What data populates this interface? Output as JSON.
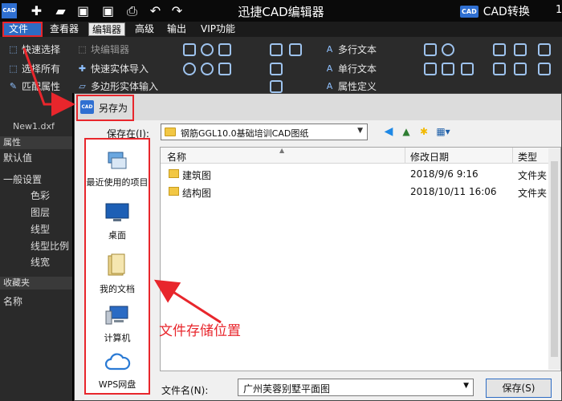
{
  "titlebar": {
    "app_logo": "CAD",
    "title": "迅捷CAD编辑器",
    "convert_badge": "CAD",
    "convert_label": "CAD转换",
    "user_fragment": "1"
  },
  "menu": {
    "file": "文件",
    "items": [
      "查看器",
      "编辑器",
      "高级",
      "输出",
      "VIP功能"
    ]
  },
  "ribbon": {
    "quick_select": "快速选择",
    "select_all": "选择所有",
    "match_props": "匹配属性",
    "block_editor": "块编辑器",
    "quick_entity_import": "快速实体导入",
    "polyline_import": "多边形实体输入",
    "multiline_text": "多行文本",
    "single_text": "单行文本",
    "attr_def": "属性定义"
  },
  "left_panel": {
    "doc_tab": "New1.dxf",
    "props_header": "属性",
    "default": "默认值",
    "general": "一般设置",
    "rows": [
      "色彩",
      "图层",
      "线型",
      "线型比例",
      "线宽"
    ],
    "favorites": "收藏夹",
    "name": "名称"
  },
  "dialog": {
    "icon": "CAD",
    "title": "另存为",
    "save_in_label": "保存在(I):",
    "save_in_value": "钢筋GGL10.0基础培训CAD图纸",
    "places": [
      "最近使用的项目",
      "桌面",
      "我的文档",
      "计算机",
      "WPS网盘"
    ],
    "columns": {
      "name": "名称",
      "date": "修改日期",
      "type": "类型"
    },
    "files": [
      {
        "name": "建筑图",
        "date": "2018/9/6 9:16",
        "type": "文件夹"
      },
      {
        "name": "结构图",
        "date": "2018/10/11 16:06",
        "type": "文件夹"
      }
    ],
    "filename_label": "文件名(N):",
    "filename_value": "广州芙蓉别墅平面图",
    "save_button": "保存(S)"
  },
  "annotation": "文件存储位置",
  "colors": {
    "accent_red": "#e8262c",
    "menu_blue": "#2d6cc4",
    "folder": "#f2c744"
  }
}
